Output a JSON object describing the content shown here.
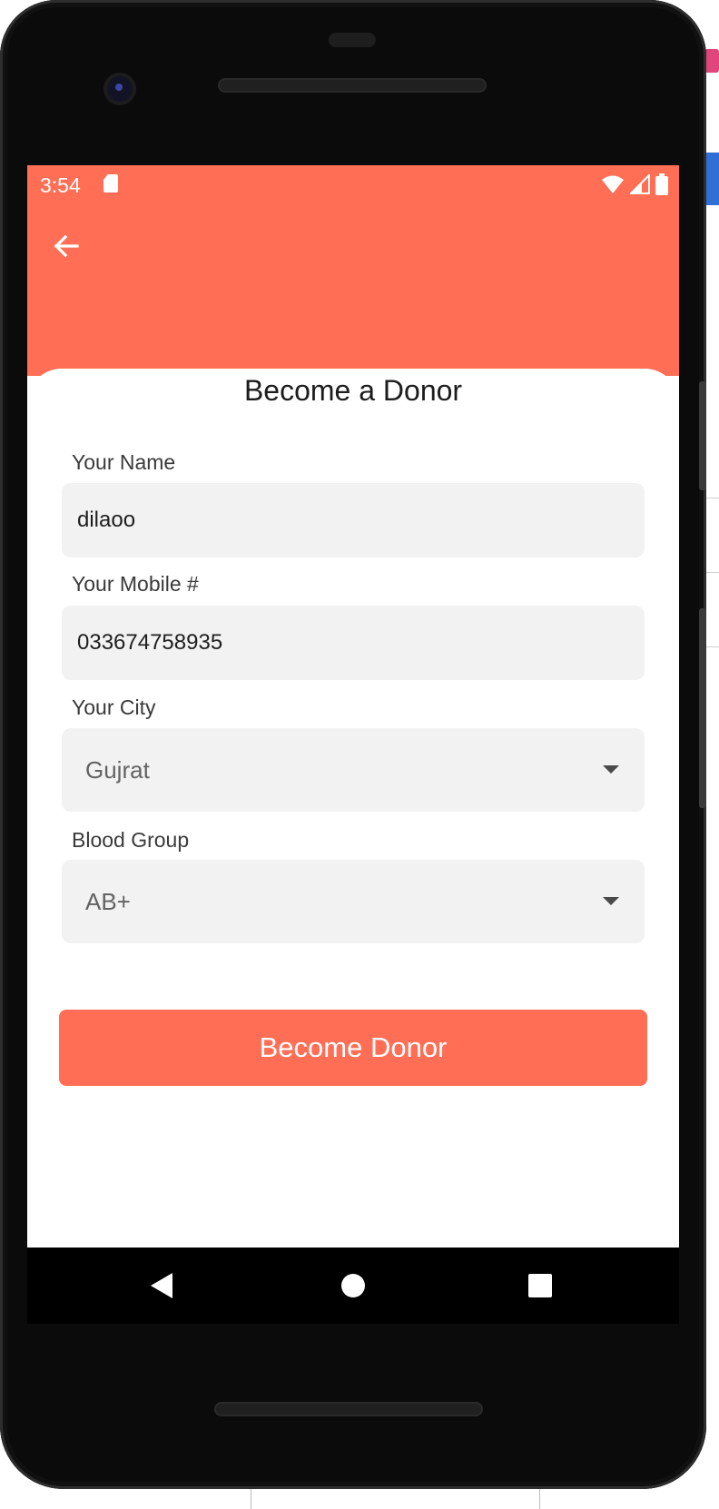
{
  "status_bar": {
    "time": "3:54",
    "icons": [
      "sd-card-icon",
      "wifi-icon",
      "signal-icon",
      "battery-icon"
    ]
  },
  "app_bar": {
    "back_icon": "arrow-back-icon"
  },
  "form": {
    "title": "Become a Donor",
    "name": {
      "label": "Your Name",
      "value": "dilaoo"
    },
    "mobile": {
      "label": "Your Mobile #",
      "value": "033674758935"
    },
    "city": {
      "label": "Your City",
      "selected": "Gujrat"
    },
    "blood_group": {
      "label": "Blood Group",
      "selected": "AB+"
    },
    "submit_label": "Become Donor"
  },
  "nav_bar": {
    "icons": [
      "nav-back-icon",
      "nav-home-icon",
      "nav-recents-icon"
    ]
  },
  "colors": {
    "accent": "#ff6e55",
    "field_bg": "#f2f2f2",
    "text": "#1c1c1c"
  }
}
